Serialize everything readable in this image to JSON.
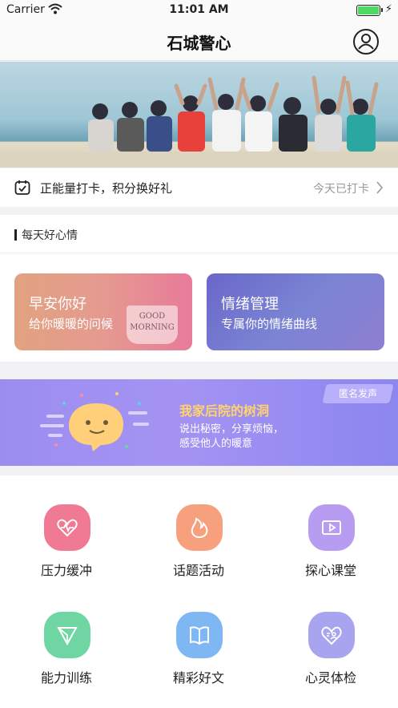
{
  "status_bar": {
    "carrier": "Carrier",
    "time": "11:01 AM"
  },
  "nav": {
    "title": "石城警心"
  },
  "checkin": {
    "text": "正能量打卡，积分换好礼",
    "status": "今天已打卡"
  },
  "daily": {
    "title": "每天好心情",
    "cards": [
      {
        "title": "早安你好",
        "subtitle": "给你暖暖的问候",
        "mug_line1": "GOOD",
        "mug_line2": "MORNING"
      },
      {
        "title": "情绪管理",
        "subtitle": "专属你的情绪曲线"
      }
    ]
  },
  "tree_hole": {
    "tag": "匿名发声",
    "title": "我家后院的树洞",
    "line1": "说出秘密，分享烦恼，",
    "line2": "感受他人的暖意"
  },
  "features": [
    {
      "label": "压力缓冲",
      "icon": "heart-pulse-icon",
      "color": "#f07a93"
    },
    {
      "label": "话题活动",
      "icon": "flame-icon",
      "color": "#f7a07d"
    },
    {
      "label": "探心课堂",
      "icon": "video-play-icon",
      "color": "#b79cf2"
    },
    {
      "label": "能力训练",
      "icon": "paper-plane-icon",
      "color": "#6fd6a3"
    },
    {
      "label": "精彩好文",
      "icon": "book-icon",
      "color": "#7fb7f2"
    },
    {
      "label": "心灵体检",
      "icon": "heart-person-icon",
      "color": "#a8a4ef"
    }
  ]
}
